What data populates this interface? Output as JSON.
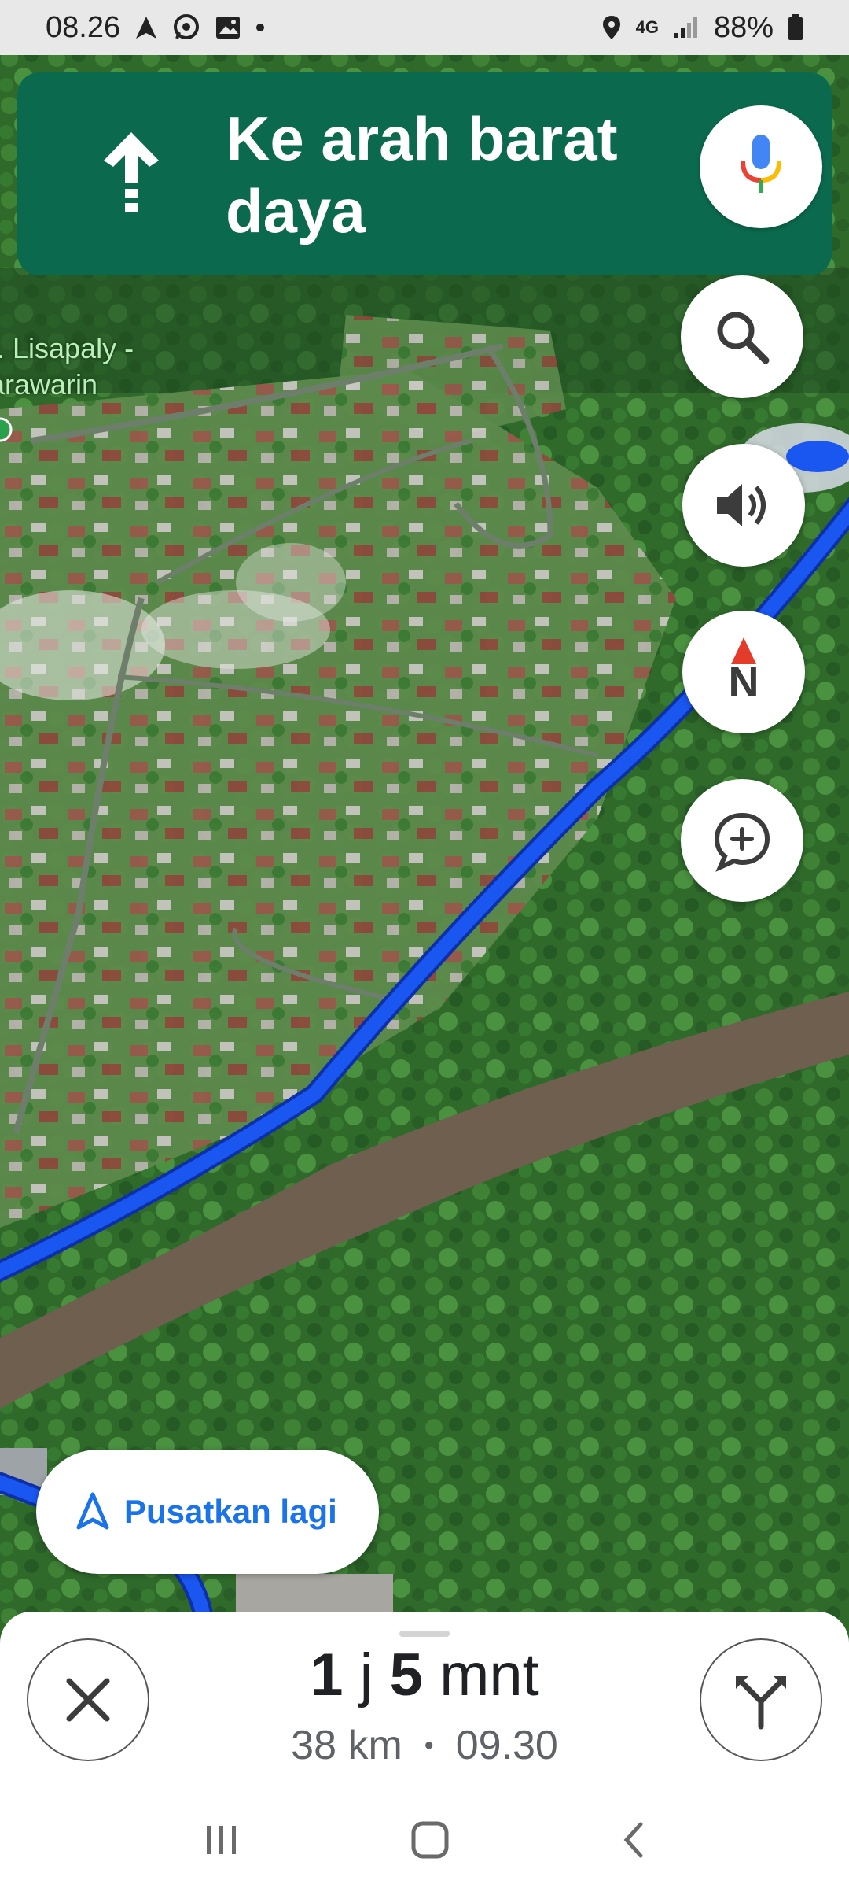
{
  "status_bar": {
    "time": "08.26",
    "network": "4G",
    "battery": "88%",
    "icons": [
      "navigation-icon",
      "whatsapp-icon",
      "gallery-icon",
      "location-icon",
      "signal-icon",
      "battery-icon"
    ]
  },
  "navigation": {
    "instruction": "Ke arah barat daya",
    "maneuver_icon": "straight-arrow-icon"
  },
  "map": {
    "place_label": "I. Lisapaly - arawarin",
    "route_color": "#1a56f0"
  },
  "controls": {
    "mic": "microphone-icon",
    "search": "search-icon",
    "sound": "volume-icon",
    "compass_letter": "N",
    "report": "add-report-icon"
  },
  "recenter": {
    "label": "Pusatkan lagi"
  },
  "trip": {
    "duration_hours": "1",
    "hour_unit": "j",
    "duration_minutes": "5",
    "minute_unit": "mnt",
    "distance": "38 km",
    "separator": "•",
    "arrival": "09.30"
  },
  "colors": {
    "banner": "#0b6a4d",
    "accent_blue": "#1a73e8"
  }
}
